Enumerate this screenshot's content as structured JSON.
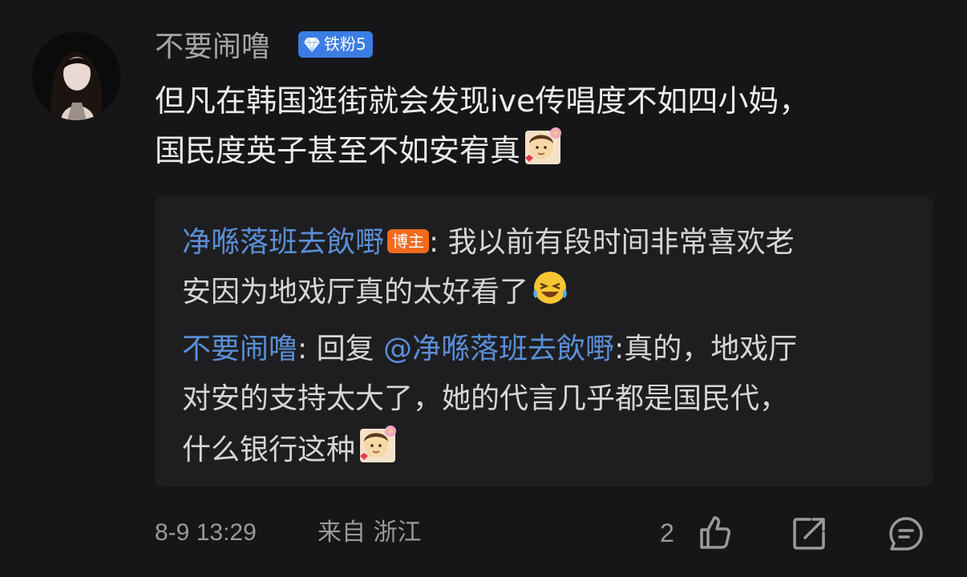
{
  "comment": {
    "username": "不要闹噜",
    "badge_label": "铁粉5",
    "text_line1": "但凡在韩国逛街就会发现ive传唱度不如四小妈，",
    "text_line2": "国民度英子甚至不如安宥真",
    "emoji": "shy-emoji"
  },
  "replies": [
    {
      "author": "净喺落班去飲嘢",
      "author_tag": "博主",
      "separator": ": ",
      "text_line1": "我以前有段时间非常喜欢老",
      "text_line2": "安因为地戏厅真的太好看了",
      "emoji": "laugh-cry-emoji"
    },
    {
      "author": "不要闹噜",
      "separator": ": ",
      "reply_prefix": "回复 ",
      "mention": "@净喺落班去飲嘢",
      "text_line1": ":真的，地戏厅",
      "text_line2": "对安的支持太大了，她的代言几乎都是国民代，",
      "text_line3": "什么银行这种",
      "emoji": "shy-emoji"
    }
  ],
  "footer": {
    "time": "8-9 13:29",
    "location": "来自 浙江",
    "like_count": "2",
    "like_icon": "thumbs-up-icon",
    "share_icon": "share-icon",
    "comment_icon": "comment-icon"
  },
  "colors": {
    "background": "#161618",
    "link": "#5b8ed6",
    "badge": "#3b7de4",
    "op_tag": "#f06b1e"
  }
}
